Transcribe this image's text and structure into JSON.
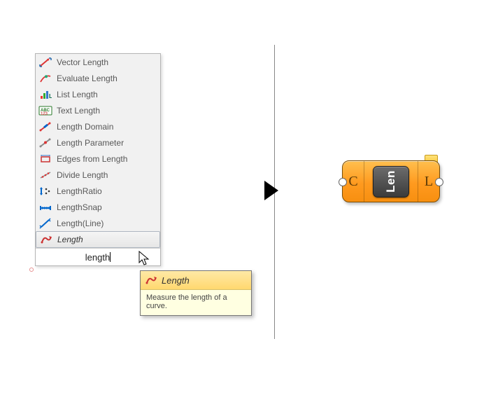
{
  "menu": {
    "items": [
      {
        "label": "Vector Length",
        "icon": "vector-length-icon"
      },
      {
        "label": "Evaluate Length",
        "icon": "evaluate-length-icon"
      },
      {
        "label": "List Length",
        "icon": "list-length-icon"
      },
      {
        "label": "Text Length",
        "icon": "text-length-icon"
      },
      {
        "label": "Length Domain",
        "icon": "length-domain-icon"
      },
      {
        "label": "Length Parameter",
        "icon": "length-parameter-icon"
      },
      {
        "label": "Edges from Length",
        "icon": "edges-from-length-icon"
      },
      {
        "label": "Divide Length",
        "icon": "divide-length-icon"
      },
      {
        "label": "LengthRatio",
        "icon": "length-ratio-icon"
      },
      {
        "label": "LengthSnap",
        "icon": "length-snap-icon"
      },
      {
        "label": "Length(Line)",
        "icon": "length-line-icon"
      },
      {
        "label": "Length",
        "icon": "length-curve-icon",
        "selected": true
      }
    ],
    "search_value": "length"
  },
  "tooltip": {
    "title": "Length",
    "description": "Measure the length of a curve."
  },
  "component": {
    "name": "Len",
    "input_label": "C",
    "output_label": "L"
  }
}
